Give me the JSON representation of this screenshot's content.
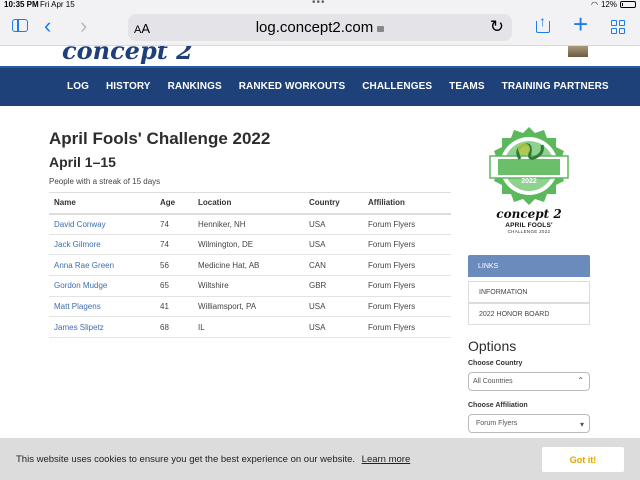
{
  "status_bar": {
    "time": "10:35 PM",
    "date": "Fri Apr 15",
    "battery": "12%",
    "battery_level": 0.12
  },
  "browser": {
    "url": "log.concept2.com",
    "aa_label_small": "A",
    "aa_label_big": "A"
  },
  "nav": {
    "items": [
      "LOG",
      "HISTORY",
      "RANKINGS",
      "RANKED WORKOUTS",
      "CHALLENGES",
      "TEAMS",
      "TRAINING PARTNERS"
    ]
  },
  "page": {
    "title": "April Fools' Challenge 2022",
    "subtitle": "April 1–15",
    "streak_text": "People with a streak of 15 days"
  },
  "table": {
    "headers": {
      "name": "Name",
      "age": "Age",
      "location": "Location",
      "country": "Country",
      "affiliation": "Affiliation"
    },
    "rows": [
      {
        "name": "David Conway",
        "age": "74",
        "location": "Henniker, NH",
        "country": "USA",
        "affiliation": "Forum Flyers"
      },
      {
        "name": "Jack Gilmore",
        "age": "74",
        "location": "Wilmington, DE",
        "country": "USA",
        "affiliation": "Forum Flyers"
      },
      {
        "name": "Anna Rae Green",
        "age": "56",
        "location": "Medicine Hat, AB",
        "country": "CAN",
        "affiliation": "Forum Flyers"
      },
      {
        "name": "Gordon Mudge",
        "age": "65",
        "location": "Wiltshire",
        "country": "GBR",
        "affiliation": "Forum Flyers"
      },
      {
        "name": "Matt Plagens",
        "age": "41",
        "location": "Williamsport, PA",
        "country": "USA",
        "affiliation": "Forum Flyers"
      },
      {
        "name": "James Slipetz",
        "age": "68",
        "location": "IL",
        "country": "USA",
        "affiliation": "Forum Flyers"
      }
    ]
  },
  "sidebar": {
    "badge_year": "2022",
    "brand_logo": "concept 2",
    "brand_line1": "APRIL FOOLS'",
    "brand_line2": "CHALLENGE 2022",
    "links_header": "LINKS",
    "links": [
      "INFORMATION",
      "2022 HONOR BOARD"
    ],
    "options_title": "Options",
    "country_label": "Choose Country",
    "country_value": "All Countries",
    "affiliation_label": "Choose Affiliation",
    "affiliation_value": "Forum Flyers"
  },
  "cookie": {
    "message": "This website uses cookies to ensure you get the best experience on our website.",
    "learn_more": "Learn more",
    "accept": "Got it!"
  },
  "colors": {
    "nav_bg": "#1d4178",
    "link": "#3d6fae",
    "badge_green": "#5cb85c",
    "accept_text": "#e5a500",
    "ios_blue": "#1a7cf5"
  },
  "icons": [
    "sidebar-icon",
    "back-icon",
    "forward-icon",
    "lock-icon",
    "reload-icon",
    "share-icon",
    "plus-icon",
    "tabs-icon",
    "wifi-icon",
    "battery-icon",
    "chevron-updown-icon",
    "chevron-down-icon"
  ]
}
